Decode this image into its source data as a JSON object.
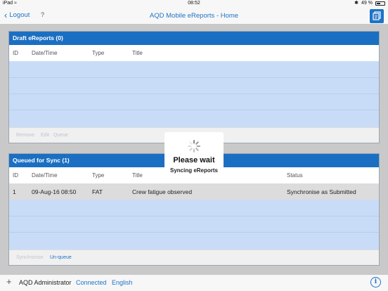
{
  "status_bar": {
    "device": "iPad",
    "time": "08:52",
    "battery": "49 %"
  },
  "nav": {
    "back_label": "Logout",
    "help": "?",
    "title": "AQD Mobile eReports - Home"
  },
  "draft": {
    "title": "Draft eReports (0)",
    "columns": [
      "ID",
      "Date/Time",
      "Type",
      "Title"
    ],
    "actions": [
      "Remove",
      "Edit",
      "Queue"
    ]
  },
  "queued": {
    "title": "Queued for Sync (1)",
    "columns": [
      "ID",
      "Date/Time",
      "Type",
      "Title",
      "Status"
    ],
    "rows": [
      {
        "id": "1",
        "datetime": "09-Aug-16 08:50",
        "type": "FAT",
        "title": "Crew fatigue observed",
        "status": "Synchronise as Submitted"
      }
    ],
    "actions": [
      "Synchronise",
      "Un-queue"
    ]
  },
  "wait": {
    "title": "Please wait",
    "subtitle": "Syncing eReports"
  },
  "bottom": {
    "user": "AQD Administrator",
    "connection": "Connected",
    "language": "English",
    "info": "i"
  },
  "colors": {
    "accent": "#1f73c6",
    "header": "#1b6fc2",
    "list_bg": "#c9dcf7"
  }
}
